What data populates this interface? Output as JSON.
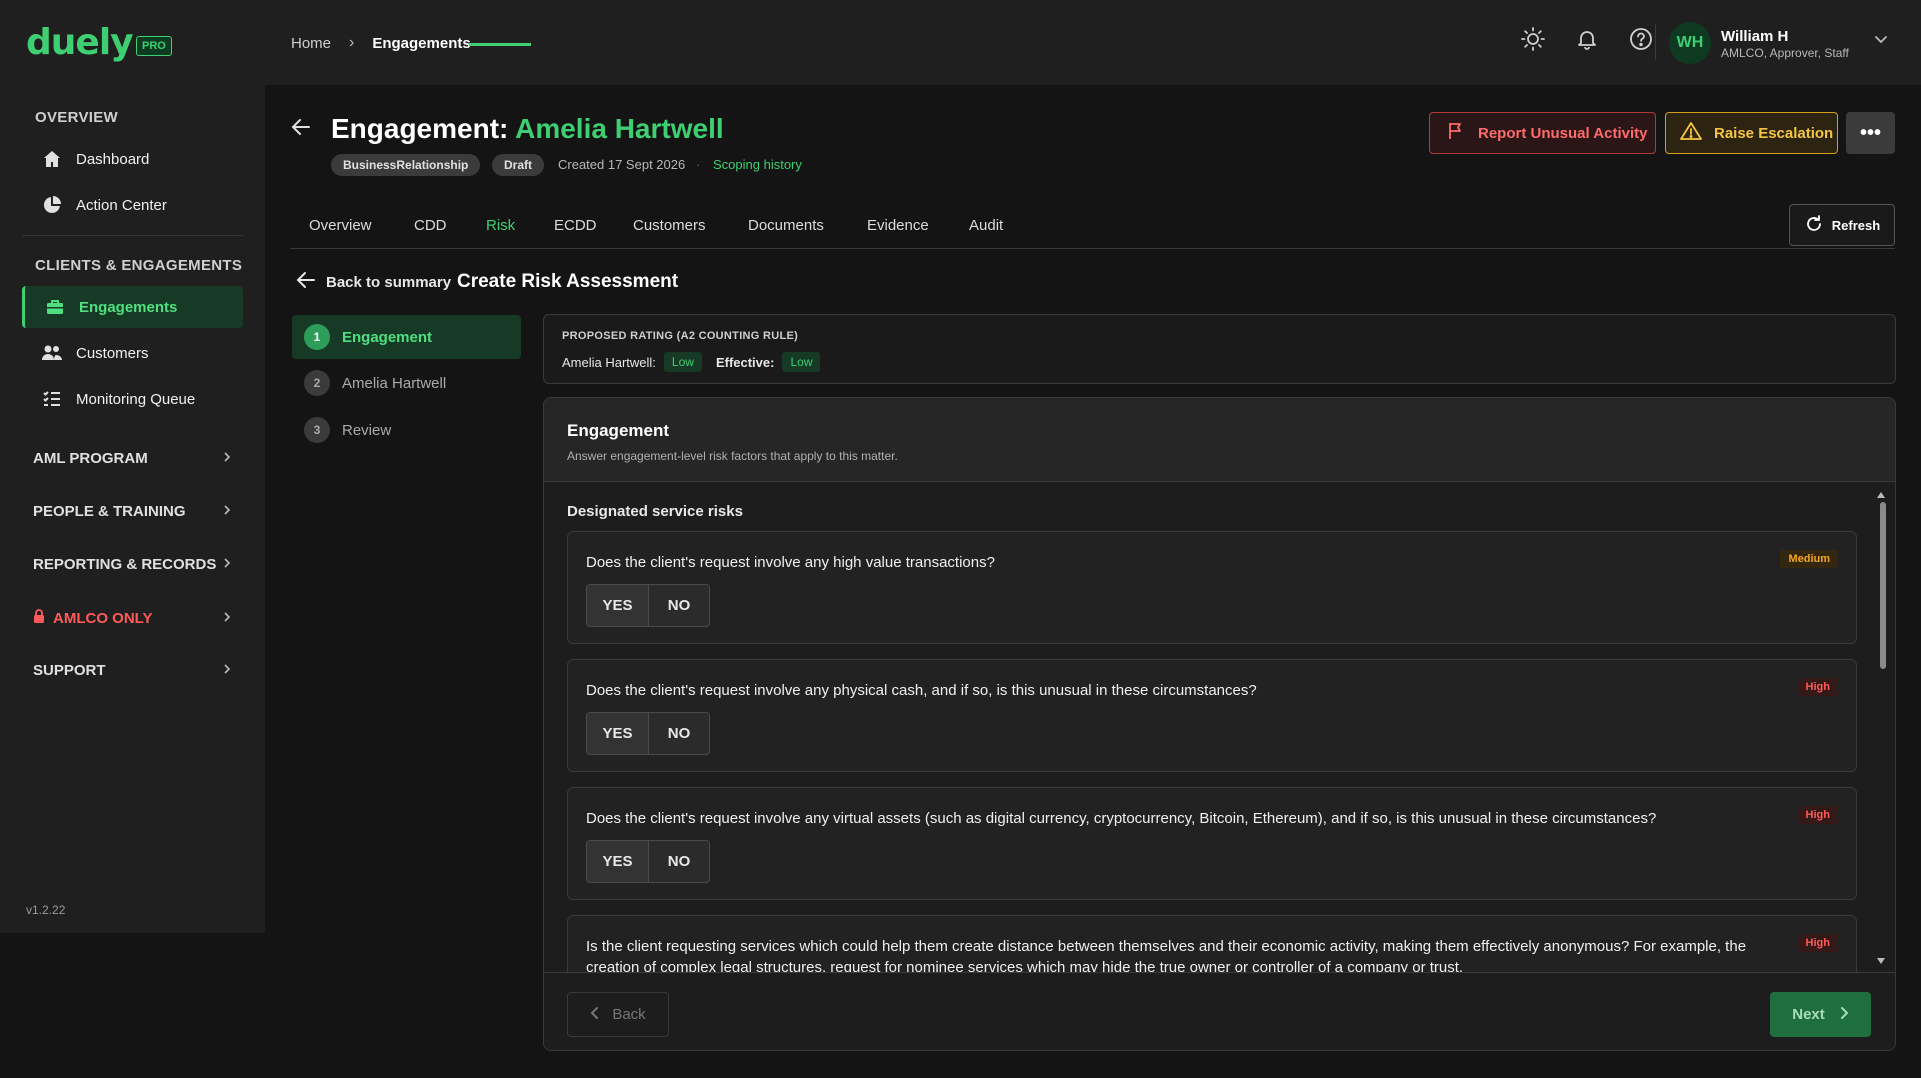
{
  "app": {
    "logo": "duely",
    "plan_badge": "PRO",
    "version": "v1.2.22"
  },
  "breadcrumb": {
    "home": "Home",
    "separator": "›",
    "current": "Engagements"
  },
  "user": {
    "initials": "WH",
    "name": "William H",
    "roles": "AMLCO, Approver, Staff"
  },
  "sidebar": {
    "overview_label": "OVERVIEW",
    "overview_items": [
      {
        "label": "Dashboard"
      },
      {
        "label": "Action Center"
      }
    ],
    "clients_label": "CLIENTS & ENGAGEMENTS",
    "clients_items": [
      {
        "label": "Engagements"
      },
      {
        "label": "Customers"
      },
      {
        "label": "Monitoring Queue"
      }
    ],
    "groups": [
      {
        "label": "AML PROGRAM"
      },
      {
        "label": "PEOPLE & TRAINING"
      },
      {
        "label": "REPORTING & RECORDS"
      },
      {
        "label": "AMLCO ONLY"
      },
      {
        "label": "SUPPORT"
      }
    ]
  },
  "engagement": {
    "title_prefix": "Engagement:",
    "client_name": "Amelia Hartwell",
    "tags": [
      "BusinessRelationship",
      "Draft"
    ],
    "created": "Created 17 Sept 2026",
    "separator": "·",
    "scoping_link": "Scoping history"
  },
  "actions": {
    "report": "Report Unusual Activity",
    "escalation": "Raise Escalation",
    "more": "•••",
    "refresh": "Refresh"
  },
  "tabs": [
    "Overview",
    "CDD",
    "Risk",
    "ECDD",
    "Customers",
    "Documents",
    "Evidence",
    "Audit"
  ],
  "active_tab": "Risk",
  "risk": {
    "back_label": "Back to summary",
    "page_title": "Create Risk Assessment",
    "steps": [
      {
        "num": "1",
        "label": "Engagement"
      },
      {
        "num": "2",
        "label": "Amelia Hartwell"
      },
      {
        "num": "3",
        "label": "Review"
      }
    ],
    "proposed": {
      "heading": "PROPOSED RATING (A2 COUNTING RULE)",
      "client_label": "Amelia Hartwell:",
      "client_rating": "Low",
      "effective_label": "Effective:",
      "effective_rating": "Low"
    },
    "panel": {
      "title": "Engagement",
      "subtitle": "Answer engagement-level risk factors that apply to this matter.",
      "section_title": "Designated service risks",
      "yes": "YES",
      "no": "NO",
      "questions": [
        {
          "text": "Does the client's request involve any high value transactions?",
          "level": "Medium"
        },
        {
          "text": "Does the client's request involve any physical cash, and if so, is this unusual in these circumstances?",
          "level": "High"
        },
        {
          "text": "Does the client's request involve any virtual assets (such as digital currency, cryptocurrency, Bitcoin, Ethereum), and if so, is this unusual in these circumstances?",
          "level": "High"
        },
        {
          "text": "Is the client requesting services which could help them create distance between themselves and their economic activity, making them effectively anonymous? For example, the creation of complex legal structures, request for nominee services which may hide the true owner or controller of a company or trust.",
          "level": "High"
        }
      ],
      "back_btn": "Back",
      "next_btn": "Next"
    }
  },
  "colors": {
    "accent": "#3ecf72",
    "danger": "#ff5a5a",
    "warning": "#f5c542",
    "background": "#141414",
    "surface": "#1f1f1f"
  }
}
